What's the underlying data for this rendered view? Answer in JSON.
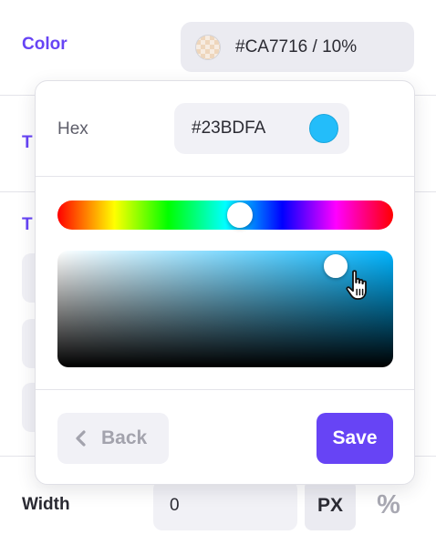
{
  "settings": {
    "color_label": "Color",
    "color_value": "#CA7716 / 10%",
    "row2_label_partial": "T",
    "row3_label_partial": "T",
    "width_label": "Width",
    "width_value": "0",
    "unit_px": "PX",
    "unit_percent": "%"
  },
  "picker": {
    "hex_label": "Hex",
    "hex_value": "#23BDFA",
    "hue_fraction": 0.54,
    "saturation_fraction": 0.83,
    "value_fraction": 0.96,
    "back_label": "Back",
    "save_label": "Save"
  },
  "colors": {
    "accent": "#6744f5",
    "picked": "#23BDFA",
    "base_color": "#CA7716"
  },
  "icons": {
    "back": "chevron-left-icon",
    "cursor": "hand-pointer-icon",
    "swatch": "checkerboard-swatch-icon"
  }
}
